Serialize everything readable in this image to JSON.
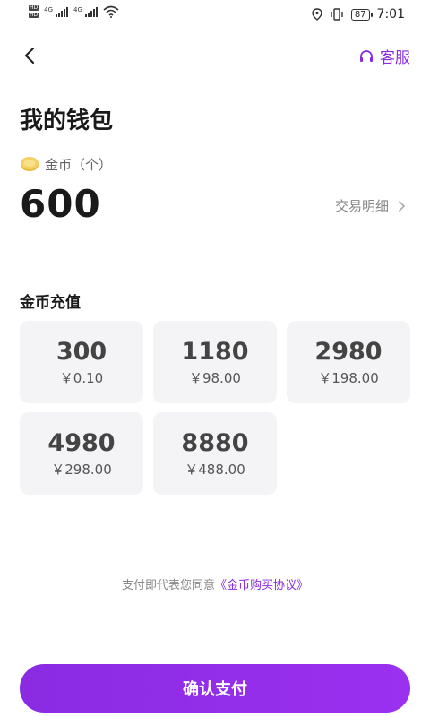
{
  "status_bar": {
    "hd1": "HD",
    "hd2": "HD",
    "net1": "4G",
    "net2": "4G",
    "battery": "87",
    "time": "7:01"
  },
  "header": {
    "back_icon": "chevron-left-icon",
    "service_icon": "headset-icon",
    "service_label": "客服"
  },
  "page_title": "我的钱包",
  "wallet": {
    "coin_icon": "gold-coin-icon",
    "coin_label": "金币（个）",
    "balance": "600",
    "detail_label": "交易明细"
  },
  "recharge": {
    "title": "金币充值",
    "packages": [
      {
        "amount": "300",
        "price": "￥0.10"
      },
      {
        "amount": "1180",
        "price": "￥98.00"
      },
      {
        "amount": "2980",
        "price": "￥198.00"
      },
      {
        "amount": "4980",
        "price": "￥298.00"
      },
      {
        "amount": "8880",
        "price": "￥488.00"
      }
    ]
  },
  "agreement": {
    "prefix": "支付即代表您同意",
    "link": "《金币购买协议》"
  },
  "pay_button": "确认支付",
  "colors": {
    "accent": "#8a2be2",
    "card_bg": "#f4f4f7"
  }
}
